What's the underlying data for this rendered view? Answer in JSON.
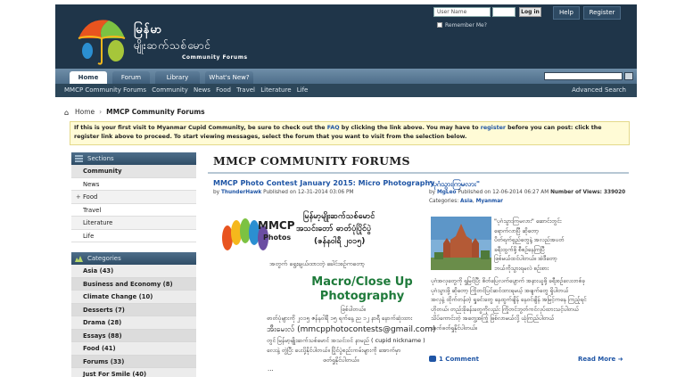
{
  "header": {
    "logo_line1": "မြန်မာ",
    "logo_line2": "မျိုးဆက်သစ်မောင်",
    "logo_line3": "Community Forums",
    "username_placeholder": "User Name",
    "login_label": "Log in",
    "remember_label": "Remember Me?",
    "help_label": "Help",
    "register_label": "Register"
  },
  "nav": {
    "tabs": [
      {
        "label": "Home"
      },
      {
        "label": "Forum"
      },
      {
        "label": "Library"
      },
      {
        "label": "What's New?"
      }
    ],
    "sub_items": [
      "MMCP Community Forums",
      "Community",
      "News",
      "Food",
      "Travel",
      "Literature",
      "Life"
    ],
    "advanced_search": "Advanced Search"
  },
  "breadcrumb": {
    "home": "Home",
    "current": "MMCP Community Forums"
  },
  "notice": {
    "p1": "If this is your first visit to Myanmar Cupid Community, be sure to check out the ",
    "faq": "FAQ",
    "p2": " by clicking the link above. You may have to ",
    "register": "register",
    "p3": " before you can post: click the register link above to proceed. To start viewing messages, select the forum that you want to visit from the selection below."
  },
  "sidebar": {
    "sections_title": "Sections",
    "sections": [
      {
        "label": "Community"
      },
      {
        "label": "News"
      },
      {
        "label": "Food"
      },
      {
        "label": "Travel"
      },
      {
        "label": "Literature"
      },
      {
        "label": "Life"
      }
    ],
    "categories_title": "Categories",
    "categories": [
      {
        "label": "Asia (43)"
      },
      {
        "label": "Business and Economy (8)"
      },
      {
        "label": "Climate Change (10)"
      },
      {
        "label": "Desserts (7)"
      },
      {
        "label": "Drama (28)"
      },
      {
        "label": "Essays (88)"
      },
      {
        "label": "Food (41)"
      },
      {
        "label": "Forums (33)"
      },
      {
        "label": "Just For Smile (40)"
      }
    ]
  },
  "main": {
    "title": "MMCP COMMUNITY FORUMS",
    "post1": {
      "title": "MMCP Photo Contest January 2015: Micro Photography",
      "by": "by",
      "author": "ThunderHawk",
      "published": "Published on 12-31-2014 03:06 PM",
      "logo_text1": "MMCP",
      "logo_text2": "Photos",
      "myanmar_lines": [
        "မြန်မာ့မျိုးဆက်သစ်မောင်",
        "အသင်းတော် ဓာတ်ပုံပြိုင်ပွဲ",
        "(ဇန်နဝါရီ ၂၀၁၅)",
        "အတွက် ရွေးချယ်ထားတဲ့ ခေါင်းစဉ်ကတော့"
      ],
      "macro_line1": "Macro/Close Up",
      "macro_line2": "Photography",
      "body_lines": [
        "ဖြစ်ပါတယ်။",
        "ဓာတ်ပုံများကို ၂၀၁၅ ဇန်နဝါရီ ၁၅ ရက်နေ့ ည ၁၂ နာရီ နောက်ဆုံးထား",
        "အီးမေးလ် (mmcpphotocontests@gmail.com)",
        "တွင် မြန်မာ့မျိုးဆက်သစ်မောင် အသင်းဝင် နာမည် ( cupid nickname )",
        "လေးနဲ့ တွဲပြီး ပေးပို့နိုင်ပါတယ်။ ပြိုင်ပွဲစည်းကမ်းများကို အောက်မှာ",
        "ဖတ်ရှုနိုင်ပါတယ်။"
      ],
      "ellipsis": "..."
    },
    "post2": {
      "title": "\"ပုဂံသွားကြမလား\"",
      "by": "by",
      "author": "MgLeo",
      "published": "Published on 12-06-2014 06:27 AM",
      "views": "Number of Views: 339020",
      "categories_label": "Categories:",
      "cat1": "Asia",
      "cat2": "Myanmar",
      "side_lines": [
        "\"ပုဂံသွားကြမလား\" ဆောင်းတွင်း",
        "ရောက်လာပြီ ဆိုတော့",
        "ပိတ်ရက်ရှည်တွေနဲ့ အလည်အပတ်",
        "ခရီးထွက်ဖို့ စီစဉ်နေကြပြီ",
        "ဖြစ်မယ်ထင်ပါတယ်။ အဲဒီတော့",
        "ဘယ်ကိုသွားရမလဲ စဉ်းစား"
      ],
      "full_lines": [
        "ပုဂံအလှတွေကို ရှုမြင်ပြီး စိတ်ပြေလက်ပျောက် အနားယူဖို့ ခရီးစဉ်လေးတစ်ခု",
        "ပုဂံသွားဖို့ ဆိုတော့ ကြိုတင်ပြင်ဆင်ထားရမယ့် အချက်တွေ ရှိပါတယ်",
        "အလှနဲ့ ထိုက်တန်တဲ့ ရှုခင်းတွေ နေထွက်ချိန် နေဝင်ချိန် အမြင့်ကနေ ကြည့်ရင်",
        "ဟိုတယ်၊ တည်းခိုခန်းတွေကိုလည်း ကြိုတင်ဘွတ်ကင်လုပ်ထားသင့်ပါတယ်",
        "သိပ်ကောင်းတဲ့ အတွေ့အကြုံ ဖြစ်လာမယ်လို့ ယုံကြည်ပါတယ်",
        "ဆက်ဖတ်ရှုနိုင်ပါတယ်။"
      ],
      "comments": "1 Comment",
      "read_more": "Read More"
    }
  },
  "colors": {
    "header_bg": "#1f3549",
    "link": "#1f55a5",
    "macro_green": "#1e7a3a"
  }
}
